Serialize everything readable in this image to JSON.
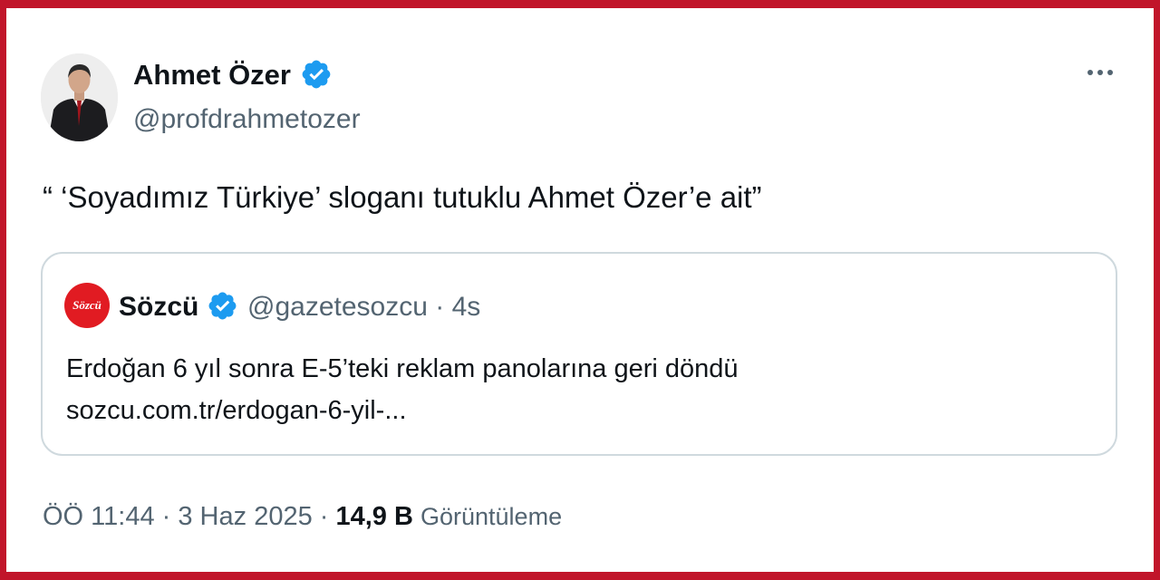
{
  "tweet": {
    "author": {
      "display_name": "Ahmet Özer",
      "handle": "@profdrahmetozer",
      "verified": true
    },
    "text": "“ ‘Soyadımız Türkiye’ sloganı tutuklu Ahmet Özer’e ait”",
    "quoted": {
      "logo_text": "Sözcü",
      "display_name": "Sözcü",
      "handle": "@gazetesozcu",
      "time": "4s",
      "verified": true,
      "text_line1": "Erdoğan 6 yıl sonra E-5’teki reklam panolarına geri döndü",
      "text_line2": "sozcu.com.tr/erdogan-6-yil-..."
    },
    "footer": {
      "time": "ÖÖ 11:44",
      "date": "3 Haz 2025",
      "views": "14,9 B",
      "views_label": "Görüntüleme"
    }
  },
  "colors": {
    "frame": "#c1152a",
    "verified": "#1d9bf0",
    "text_primary": "#0f1419",
    "text_secondary": "#536471",
    "quote_border": "#cfd9de",
    "sozcu_red": "#e11b22"
  },
  "icons": {
    "verified": "verified-badge-icon",
    "more": "more-options-icon"
  }
}
